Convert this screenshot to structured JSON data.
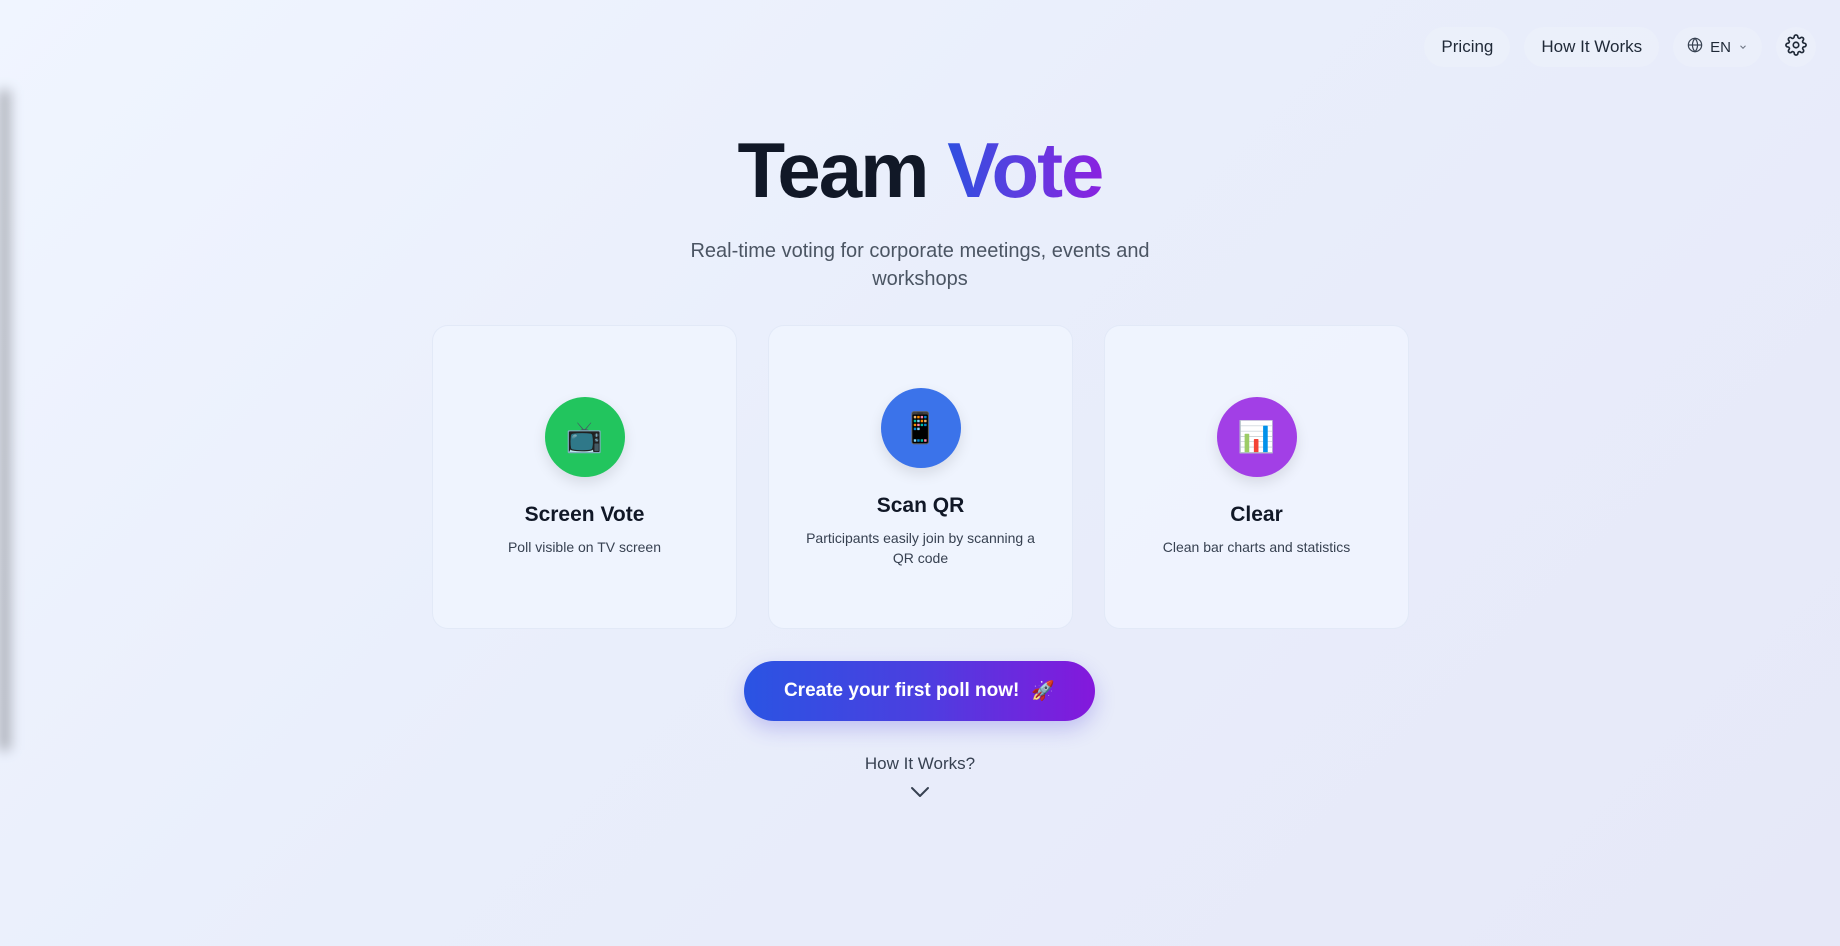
{
  "nav": {
    "pricing_label": "Pricing",
    "how_label": "How It Works",
    "language_label": "EN",
    "globe_icon": "globe-icon",
    "settings_icon": "gear-icon"
  },
  "hero": {
    "title_part1": "Team",
    "title_part2": "Vote",
    "subtitle": "Real-time voting for corporate meetings, events and workshops"
  },
  "features": [
    {
      "icon": "📺",
      "icon_name": "tv-icon",
      "color": "#22c55e",
      "title": "Screen Vote",
      "desc": "Poll visible on TV screen"
    },
    {
      "icon": "📱",
      "icon_name": "mobile-phone-icon",
      "color": "#3b73ea",
      "title": "Scan QR",
      "desc": "Participants easily join by scanning a QR code"
    },
    {
      "icon": "📊",
      "icon_name": "bar-chart-icon",
      "color": "#a23fe6",
      "title": "Clear",
      "desc": "Clean bar charts and statistics"
    }
  ],
  "cta": {
    "label": "Create your first poll now!",
    "icon": "🚀"
  },
  "how_it_works": {
    "label": "How It Works?"
  },
  "colors": {
    "gradient_start": "#2a54e3",
    "gradient_end": "#8418dc"
  }
}
